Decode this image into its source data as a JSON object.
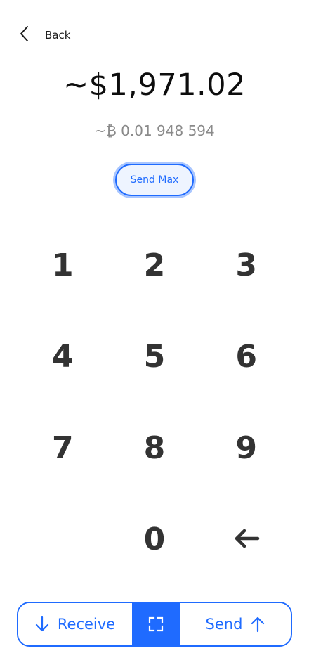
{
  "header": {
    "back_label": "Back"
  },
  "amount": {
    "fiat": "~$1,971.02",
    "crypto": "~₿ 0.01 948 594"
  },
  "send_max_label": "Send Max",
  "keypad": {
    "keys": [
      "1",
      "2",
      "3",
      "4",
      "5",
      "6",
      "7",
      "8",
      "9",
      "0"
    ]
  },
  "actions": {
    "receive_label": "Receive",
    "send_label": "Send"
  },
  "colors": {
    "accent": "#1f6bff",
    "key_text": "#333333",
    "secondary_text": "#8a8a8a"
  },
  "icons": {
    "back": "chevron-left-icon",
    "backspace": "arrow-left-icon",
    "receive": "arrow-down-icon",
    "scan": "scan-frame-icon",
    "send": "arrow-up-icon"
  }
}
